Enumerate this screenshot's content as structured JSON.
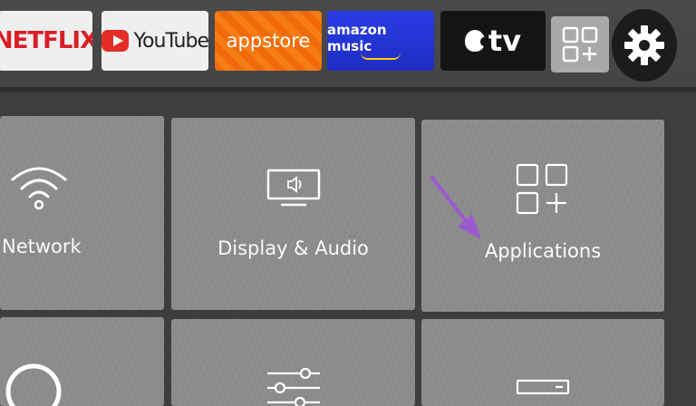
{
  "top_row": {
    "netflix_label": "NETFLIX",
    "youtube_label": "YouTube",
    "appstore_label": "appstore",
    "amazon_music_label": "amazon music",
    "appletv_label": "tv"
  },
  "settings_tiles": {
    "network_label": "Network",
    "display_audio_label": "Display & Audio",
    "applications_label": "Applications"
  },
  "colors": {
    "netflix_red": "#d81f26",
    "youtube_red": "#e52d27",
    "appstore_orange": "#f06a0c",
    "amazon_blue": "#2a3ce4",
    "cursor_purple": "#9b59d0"
  }
}
